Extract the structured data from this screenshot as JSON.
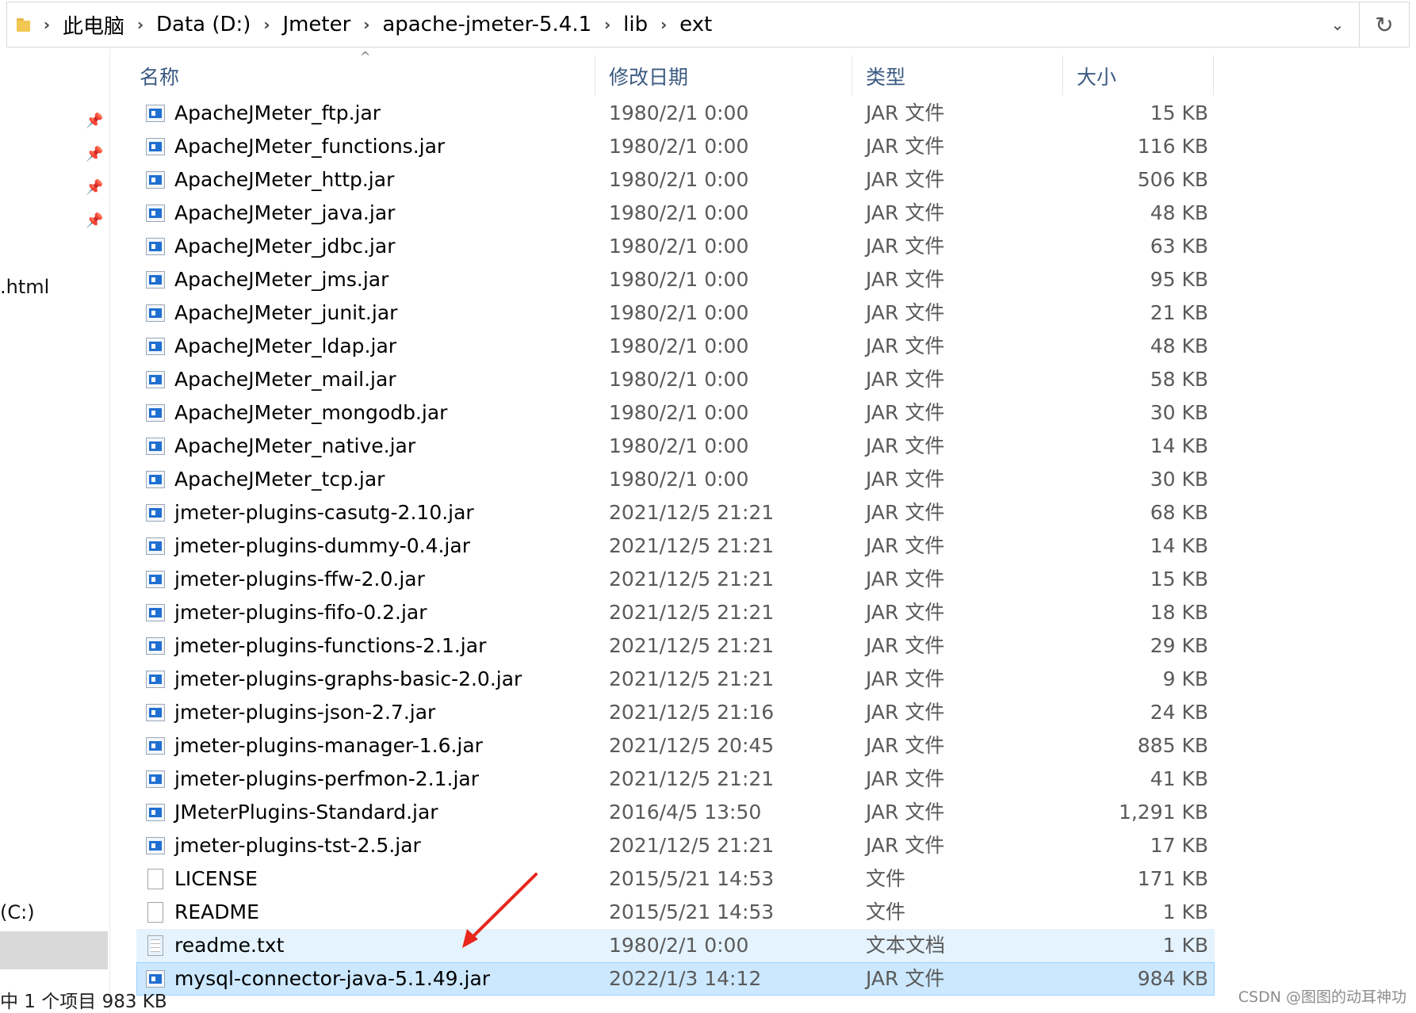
{
  "breadcrumb": [
    "此电脑",
    "Data (D:)",
    "Jmeter",
    "apache-jmeter-5.4.1",
    "lib",
    "ext"
  ],
  "address_bar": {
    "dropdown_icon": "chevron-down-icon",
    "refresh_icon": "refresh-icon"
  },
  "nav_pane": {
    "truncated_labels": {
      "html_file": ".html",
      "drive_c": "(C:)"
    }
  },
  "columns": {
    "name": "名称",
    "date": "修改日期",
    "type": "类型",
    "size": "大小"
  },
  "files": [
    {
      "name": "ApacheJMeter_ftp.jar",
      "date": "1980/2/1 0:00",
      "type": "JAR 文件",
      "size": "15 KB",
      "icon": "jar"
    },
    {
      "name": "ApacheJMeter_functions.jar",
      "date": "1980/2/1 0:00",
      "type": "JAR 文件",
      "size": "116 KB",
      "icon": "jar"
    },
    {
      "name": "ApacheJMeter_http.jar",
      "date": "1980/2/1 0:00",
      "type": "JAR 文件",
      "size": "506 KB",
      "icon": "jar"
    },
    {
      "name": "ApacheJMeter_java.jar",
      "date": "1980/2/1 0:00",
      "type": "JAR 文件",
      "size": "48 KB",
      "icon": "jar"
    },
    {
      "name": "ApacheJMeter_jdbc.jar",
      "date": "1980/2/1 0:00",
      "type": "JAR 文件",
      "size": "63 KB",
      "icon": "jar"
    },
    {
      "name": "ApacheJMeter_jms.jar",
      "date": "1980/2/1 0:00",
      "type": "JAR 文件",
      "size": "95 KB",
      "icon": "jar"
    },
    {
      "name": "ApacheJMeter_junit.jar",
      "date": "1980/2/1 0:00",
      "type": "JAR 文件",
      "size": "21 KB",
      "icon": "jar"
    },
    {
      "name": "ApacheJMeter_ldap.jar",
      "date": "1980/2/1 0:00",
      "type": "JAR 文件",
      "size": "48 KB",
      "icon": "jar"
    },
    {
      "name": "ApacheJMeter_mail.jar",
      "date": "1980/2/1 0:00",
      "type": "JAR 文件",
      "size": "58 KB",
      "icon": "jar"
    },
    {
      "name": "ApacheJMeter_mongodb.jar",
      "date": "1980/2/1 0:00",
      "type": "JAR 文件",
      "size": "30 KB",
      "icon": "jar"
    },
    {
      "name": "ApacheJMeter_native.jar",
      "date": "1980/2/1 0:00",
      "type": "JAR 文件",
      "size": "14 KB",
      "icon": "jar"
    },
    {
      "name": "ApacheJMeter_tcp.jar",
      "date": "1980/2/1 0:00",
      "type": "JAR 文件",
      "size": "30 KB",
      "icon": "jar"
    },
    {
      "name": "jmeter-plugins-casutg-2.10.jar",
      "date": "2021/12/5 21:21",
      "type": "JAR 文件",
      "size": "68 KB",
      "icon": "jar"
    },
    {
      "name": "jmeter-plugins-dummy-0.4.jar",
      "date": "2021/12/5 21:21",
      "type": "JAR 文件",
      "size": "14 KB",
      "icon": "jar"
    },
    {
      "name": "jmeter-plugins-ffw-2.0.jar",
      "date": "2021/12/5 21:21",
      "type": "JAR 文件",
      "size": "15 KB",
      "icon": "jar"
    },
    {
      "name": "jmeter-plugins-fifo-0.2.jar",
      "date": "2021/12/5 21:21",
      "type": "JAR 文件",
      "size": "18 KB",
      "icon": "jar"
    },
    {
      "name": "jmeter-plugins-functions-2.1.jar",
      "date": "2021/12/5 21:21",
      "type": "JAR 文件",
      "size": "29 KB",
      "icon": "jar"
    },
    {
      "name": "jmeter-plugins-graphs-basic-2.0.jar",
      "date": "2021/12/5 21:21",
      "type": "JAR 文件",
      "size": "9 KB",
      "icon": "jar"
    },
    {
      "name": "jmeter-plugins-json-2.7.jar",
      "date": "2021/12/5 21:16",
      "type": "JAR 文件",
      "size": "24 KB",
      "icon": "jar"
    },
    {
      "name": "jmeter-plugins-manager-1.6.jar",
      "date": "2021/12/5 20:45",
      "type": "JAR 文件",
      "size": "885 KB",
      "icon": "jar"
    },
    {
      "name": "jmeter-plugins-perfmon-2.1.jar",
      "date": "2021/12/5 21:21",
      "type": "JAR 文件",
      "size": "41 KB",
      "icon": "jar"
    },
    {
      "name": "JMeterPlugins-Standard.jar",
      "date": "2016/4/5 13:50",
      "type": "JAR 文件",
      "size": "1,291 KB",
      "icon": "jar"
    },
    {
      "name": "jmeter-plugins-tst-2.5.jar",
      "date": "2021/12/5 21:21",
      "type": "JAR 文件",
      "size": "17 KB",
      "icon": "jar"
    },
    {
      "name": "LICENSE",
      "date": "2015/5/21 14:53",
      "type": "文件",
      "size": "171 KB",
      "icon": "doc"
    },
    {
      "name": "README",
      "date": "2015/5/21 14:53",
      "type": "文件",
      "size": "1 KB",
      "icon": "doc"
    },
    {
      "name": "readme.txt",
      "date": "1980/2/1 0:00",
      "type": "文本文档",
      "size": "1 KB",
      "icon": "txt",
      "state": "hover"
    },
    {
      "name": "mysql-connector-java-5.1.49.jar",
      "date": "2022/1/3 14:12",
      "type": "JAR 文件",
      "size": "984 KB",
      "icon": "jar",
      "state": "selected"
    }
  ],
  "status_bar": {
    "text": "中 1 个项目  983 KB"
  },
  "watermark": "CSDN @图图的动耳神功",
  "colors": {
    "selection": "#cce8ff",
    "hover": "#e5f3ff",
    "annotation_arrow": "#e8261b",
    "header_text": "#3b5a82"
  }
}
